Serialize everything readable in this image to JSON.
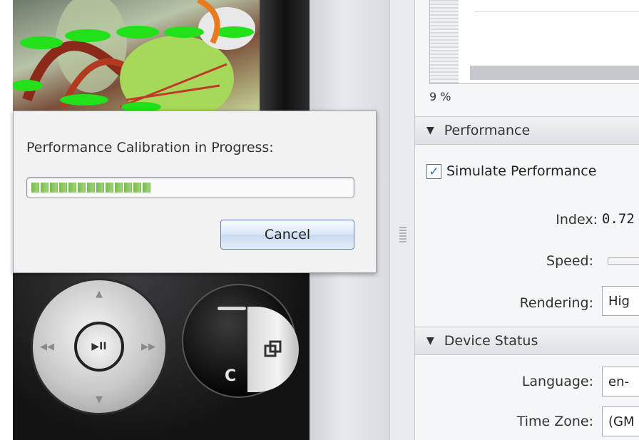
{
  "dialog": {
    "title": "Performance Calibration in Progress:",
    "progress_fraction": 0.38,
    "cancel_label": "Cancel"
  },
  "device": {
    "center_button_label": "▶II",
    "c_key_label": "C"
  },
  "panel": {
    "percent_label": "9 %",
    "performance": {
      "header": "Performance",
      "simulate_label": "Simulate Performance",
      "simulate_checked": true,
      "index_label": "Index:",
      "index_value": "0.72",
      "speed_label": "Speed:",
      "rendering_label": "Rendering:",
      "rendering_value": "Hig"
    },
    "device_status": {
      "header": "Device Status",
      "language_label": "Language:",
      "language_value": "en-",
      "timezone_label": "Time Zone:",
      "timezone_value": "(GM"
    }
  },
  "colors": {
    "progress_green": "#78b94f",
    "dialog_bg": "#f2f2f2",
    "panel_bg": "#f5f6f7"
  }
}
